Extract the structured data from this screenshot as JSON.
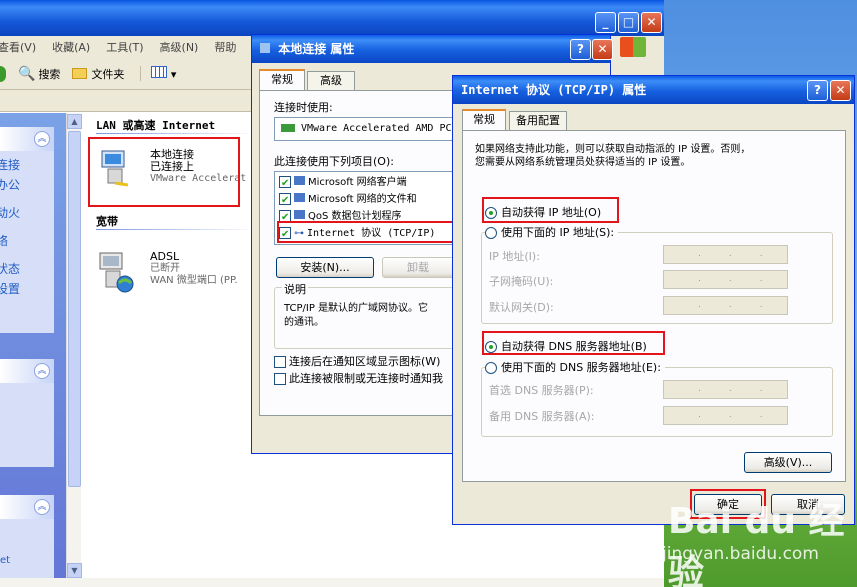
{
  "explorer": {
    "menu": [
      "查看(V)",
      "收藏(A)",
      "工具(T)",
      "高级(N)",
      "帮助"
    ],
    "toolbar": {
      "search": "搜索",
      "folders": "文件夹"
    },
    "left_links_box1": [
      "连接",
      "办公",
      "动火",
      "络",
      "",
      "状态",
      "设置"
    ],
    "left_links_box3": [
      "et"
    ],
    "group_lan": "LAN 或高速 Internet",
    "group_broadband": "宽带",
    "lan_item": {
      "name": "本地连接",
      "status": "已连接上",
      "device": "VMware Accelerat"
    },
    "adsl_item": {
      "name": "ADSL",
      "status": "已断开",
      "device": "WAN 微型端口 (PP."
    }
  },
  "lan_dialog": {
    "title": "本地连接 属性",
    "tabs": [
      "常规",
      "高级"
    ],
    "connect_using_label": "连接时使用:",
    "adapter": "VMware Accelerated AMD PC",
    "items_label": "此连接使用下列项目(O):",
    "items": [
      {
        "label": "Microsoft 网络客户端",
        "checked": true
      },
      {
        "label": "Microsoft 网络的文件和",
        "checked": true
      },
      {
        "label": "QoS 数据包计划程序",
        "checked": true
      },
      {
        "label": "Internet 协议 (TCP/IP)",
        "checked": true
      }
    ],
    "install_button": "安装(N)...",
    "uninstall_button": "卸载",
    "desc_title": "说明",
    "desc_text_1": "TCP/IP 是默认的广域网协议。它",
    "desc_text_2": "的通讯。",
    "notify_label": "连接后在通知区域显示图标(W)",
    "limited_label": "此连接被限制或无连接时通知我"
  },
  "tcpip_dialog": {
    "title": "Internet 协议 (TCP/IP) 属性",
    "tabs": [
      "常规",
      "备用配置"
    ],
    "intro_1": "如果网络支持此功能，则可以获取自动指派的 IP 设置。否则，",
    "intro_2": "您需要从网络系统管理员处获得适当的 IP 设置。",
    "auto_ip": "自动获得 IP 地址(O)",
    "manual_ip": "使用下面的 IP 地址(S):",
    "ip_address": "IP 地址(I):",
    "subnet_mask": "子网掩码(U):",
    "default_gateway": "默认网关(D):",
    "auto_dns": "自动获得 DNS 服务器地址(B)",
    "manual_dns": "使用下面的 DNS 服务器地址(E):",
    "preferred_dns": "首选 DNS 服务器(P):",
    "alternate_dns": "备用 DNS 服务器(A):",
    "advanced_button": "高级(V)...",
    "ok_button": "确定",
    "cancel_button": "取消",
    "ip_dots": "...",
    "auto_ip_selected": true,
    "auto_dns_selected": true
  },
  "watermark": {
    "brand": "Bai du 经验",
    "url": "jingyan.baidu.com"
  },
  "colors": {
    "highlight": "#e2141c",
    "xp_blue": "#0a5ae6",
    "dialog_bg": "#ece9d8"
  }
}
